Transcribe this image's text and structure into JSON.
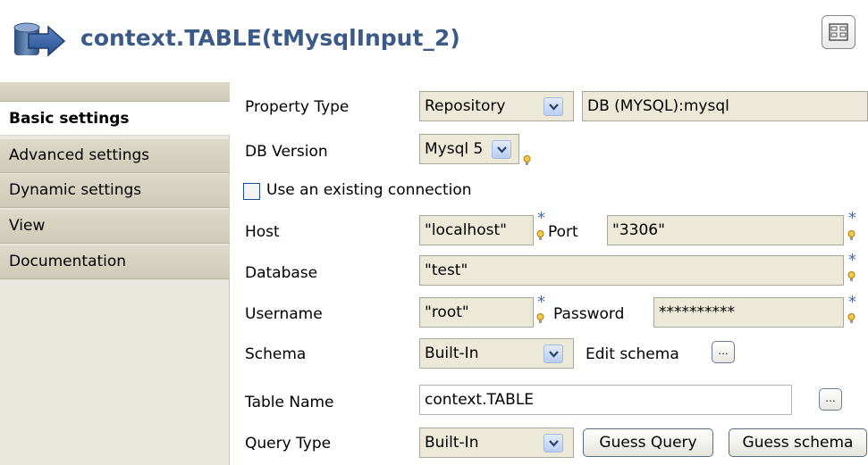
{
  "header": {
    "title": "context.TABLE(tMysqlInput_2)"
  },
  "tabs": [
    {
      "label": "Basic settings",
      "selected": true
    },
    {
      "label": "Advanced settings",
      "selected": false
    },
    {
      "label": "Dynamic settings",
      "selected": false
    },
    {
      "label": "View",
      "selected": false
    },
    {
      "label": "Documentation",
      "selected": false
    }
  ],
  "form": {
    "property_type": {
      "label": "Property Type",
      "value": "Repository",
      "repo_value": "DB (MYSQL):mysql"
    },
    "db_version": {
      "label": "DB Version",
      "value": "Mysql 5"
    },
    "use_existing": {
      "label": "Use an existing connection",
      "checked": false
    },
    "host": {
      "label": "Host",
      "value": "\"localhost\""
    },
    "port": {
      "label": "Port",
      "value": "\"3306\""
    },
    "database": {
      "label": "Database",
      "value": "\"test\""
    },
    "username": {
      "label": "Username",
      "value": "\"root\""
    },
    "password": {
      "label": "Password",
      "value": "**********"
    },
    "schema": {
      "label": "Schema",
      "value": "Built-In",
      "edit_label": "Edit schema"
    },
    "table_name": {
      "label": "Table Name",
      "value": "context.TABLE"
    },
    "query_type": {
      "label": "Query Type",
      "value": "Built-In"
    },
    "guess_query_label": "Guess Query",
    "guess_schema_label": "Guess schema",
    "dots_label": "...",
    "required_mark": "*"
  },
  "colors": {
    "title": "#3c5a87",
    "sidebar": "#e9e8df",
    "readonly_field": "#ece9d8"
  }
}
